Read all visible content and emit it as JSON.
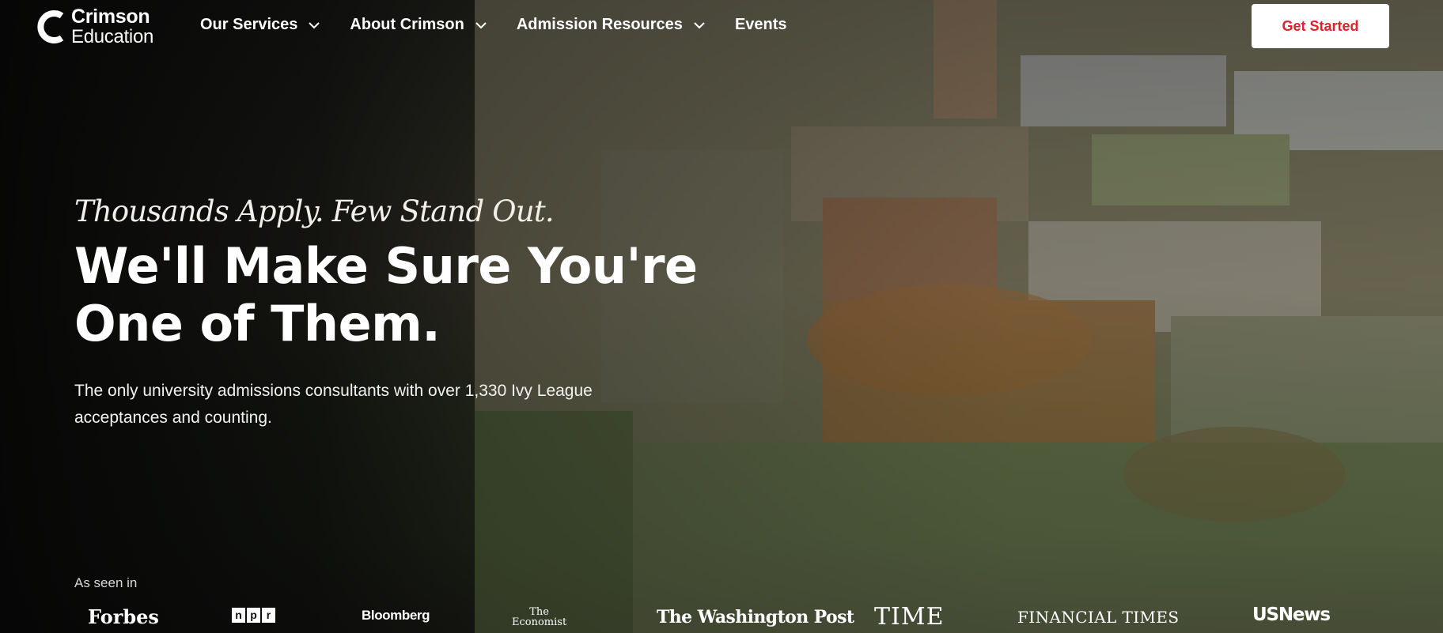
{
  "brand": {
    "name_line1": "Crimson",
    "name_line2": "Education"
  },
  "nav": {
    "items": [
      {
        "label": "Our Services",
        "has_dropdown": true
      },
      {
        "label": "About Crimson",
        "has_dropdown": true
      },
      {
        "label": "Admission Resources",
        "has_dropdown": true
      },
      {
        "label": "Events",
        "has_dropdown": false
      }
    ],
    "cta_label": "Get Started"
  },
  "hero": {
    "tagline": "Thousands Apply. Few Stand Out.",
    "headline_line1": "We'll Make Sure You're",
    "headline_line2": "One of Them.",
    "subtext": "The only university admissions consultants with over 1,330 Ivy League acceptances and counting."
  },
  "press": {
    "label": "As seen in",
    "outlets": {
      "forbes": "Forbes",
      "npr_letters": [
        "n",
        "p",
        "r"
      ],
      "bloomberg": "Bloomberg",
      "economist_line1": "The",
      "economist_line2": "Economist",
      "wapo": "The Washington Post",
      "time": "TIME",
      "ft": "FINANCIAL TIMES",
      "usnews": "USNews"
    }
  },
  "colors": {
    "accent": "#e4202a",
    "cta_bg": "#ffffff",
    "text": "#ffffff"
  }
}
